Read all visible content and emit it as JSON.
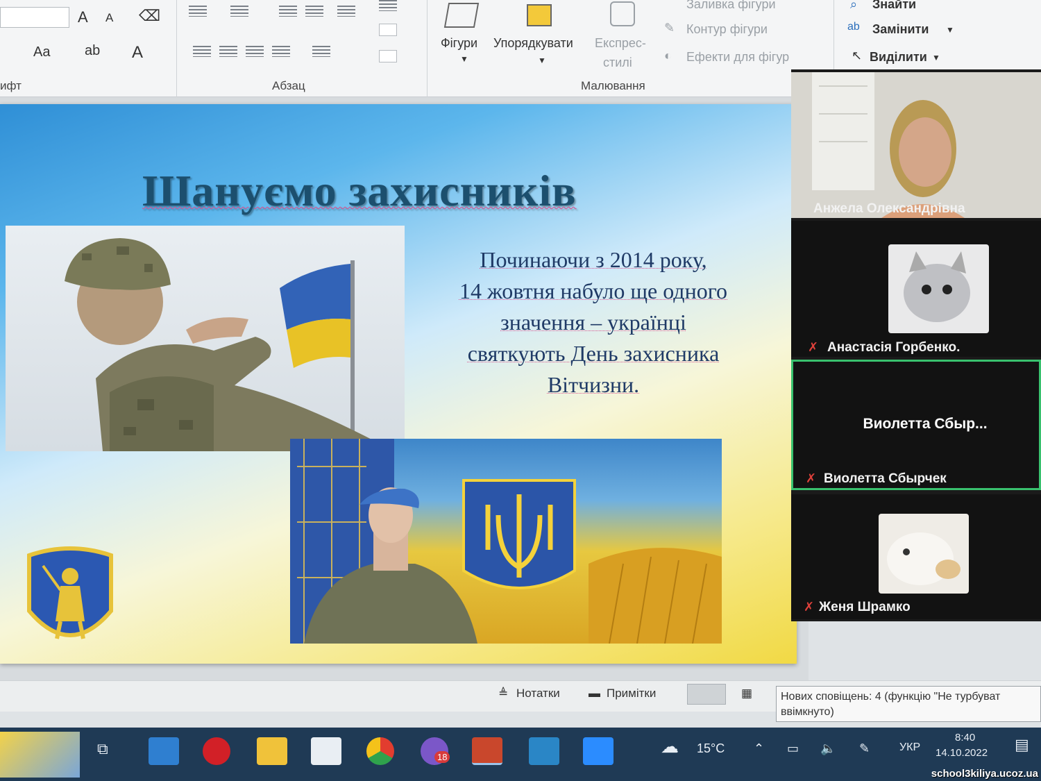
{
  "ribbon": {
    "font_group_label": "ифт",
    "paragraph_group_label": "Абзац",
    "drawing_group_label": "Малювання",
    "shapes_label": "Фігури",
    "arrange_label": "Упорядкувати",
    "quick_styles_label_1": "Експрес-",
    "quick_styles_label_2": "стилі",
    "shape_fill_label": "Заливка фігури",
    "shape_outline_label": "Контур фігури",
    "shape_effects_label": "Ефекти для фігур",
    "find_label": "Знайти",
    "replace_label": "Замінити",
    "select_label": "Виділити",
    "font_size_up": "A",
    "font_size_down": "A",
    "change_case": "Aa",
    "font_color": "A"
  },
  "slide": {
    "title": "Шануємо захисників",
    "text_lines": [
      "Починаючи з 2014 року,",
      "14 жовтня набуло ще одного",
      "значення – українці",
      "святкують День захисника",
      "Вітчизни."
    ]
  },
  "participants": [
    {
      "name": "Анжела Олександрівна",
      "muted": false
    },
    {
      "name": "Анастасія Горбенко.",
      "muted": true
    },
    {
      "name": "Виолетта Сбырчек",
      "center_label": "Виолетта  Сбыр...",
      "muted": true
    },
    {
      "name": "Женя Шрамко",
      "muted": true
    }
  ],
  "statusbar": {
    "notes_label": "Нотатки",
    "comments_label": "Примітки"
  },
  "notification": {
    "text": "Нових сповіщень: 4 (функцію \"Не турбуват ввімкнуто)"
  },
  "taskbar": {
    "viber_badge": "18",
    "weather": "15°C",
    "language": "УКР",
    "time": "8:40",
    "date": "14.10.2022"
  },
  "watermark": "school3kiliya.ucoz.ua",
  "colors": {
    "flag_blue": "#2f6fd0",
    "flag_yellow": "#f2cf2a",
    "panel_bg": "#1b1b1b",
    "active_speaker": "#39c16e",
    "taskbar": "#1f3a55"
  }
}
